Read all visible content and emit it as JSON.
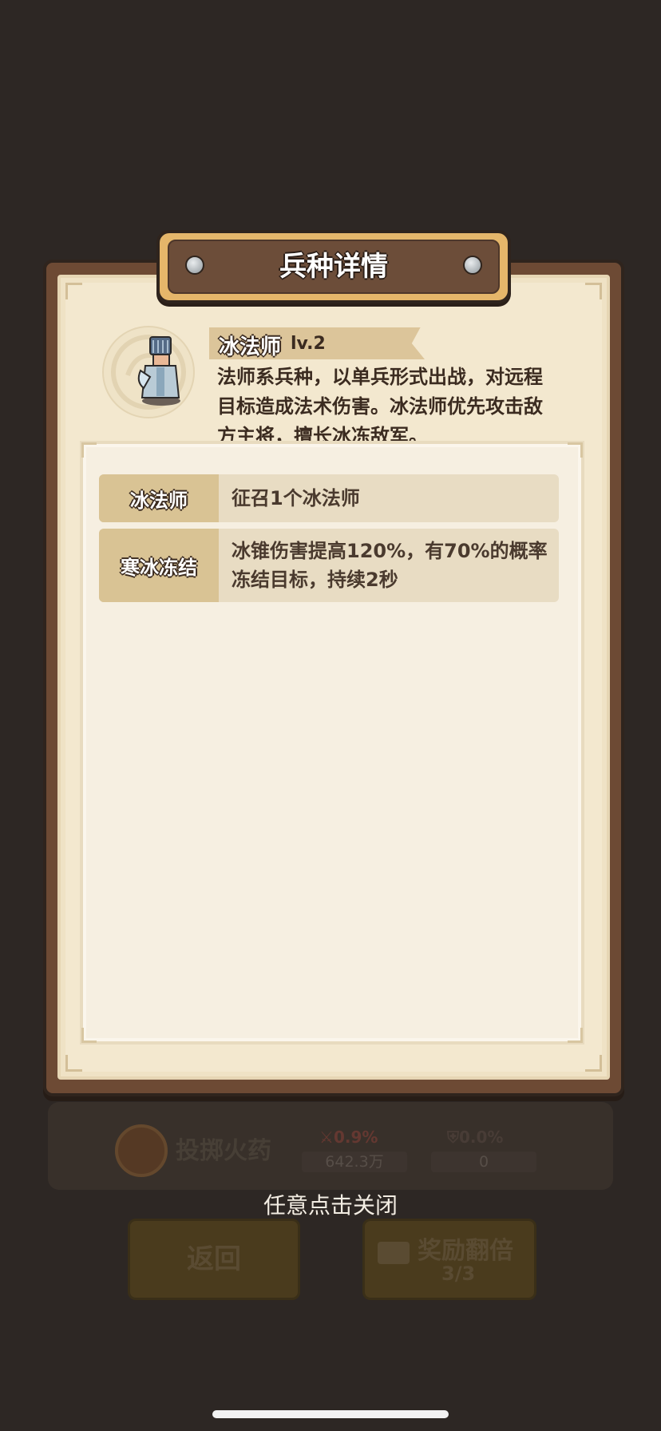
{
  "modal": {
    "title": "兵种详情",
    "unit": {
      "name": "冰法师",
      "level": "lv.2",
      "description": "法师系兵种，以单兵形式出战，对远程目标造成法术伤害。冰法师优先攻击敌方主将，擅长冰冻敌军。"
    },
    "skills": [
      {
        "name": "冰法师",
        "description": "征召1个冰法师"
      },
      {
        "name": "寒冰冻结",
        "description": "冰锥伤害提高120%，有70%的概率冻结目标，持续2秒"
      }
    ]
  },
  "close_hint": "任意点击关闭",
  "background": {
    "row": {
      "name": "投掷火药",
      "attack_percent": "0.9%",
      "attack_value": "642.3万",
      "defense_percent": "0.0%",
      "defense_value": "0"
    },
    "buttons": {
      "back": "返回",
      "double_reward": "奖励翻倍",
      "double_reward_count": "3/3"
    }
  },
  "colors": {
    "overlay": "#2d2724",
    "paper": "#f3e8cf",
    "frame": "#6d4a34",
    "title_plate": "#e5b66a",
    "skill_label": "#d9c394"
  }
}
